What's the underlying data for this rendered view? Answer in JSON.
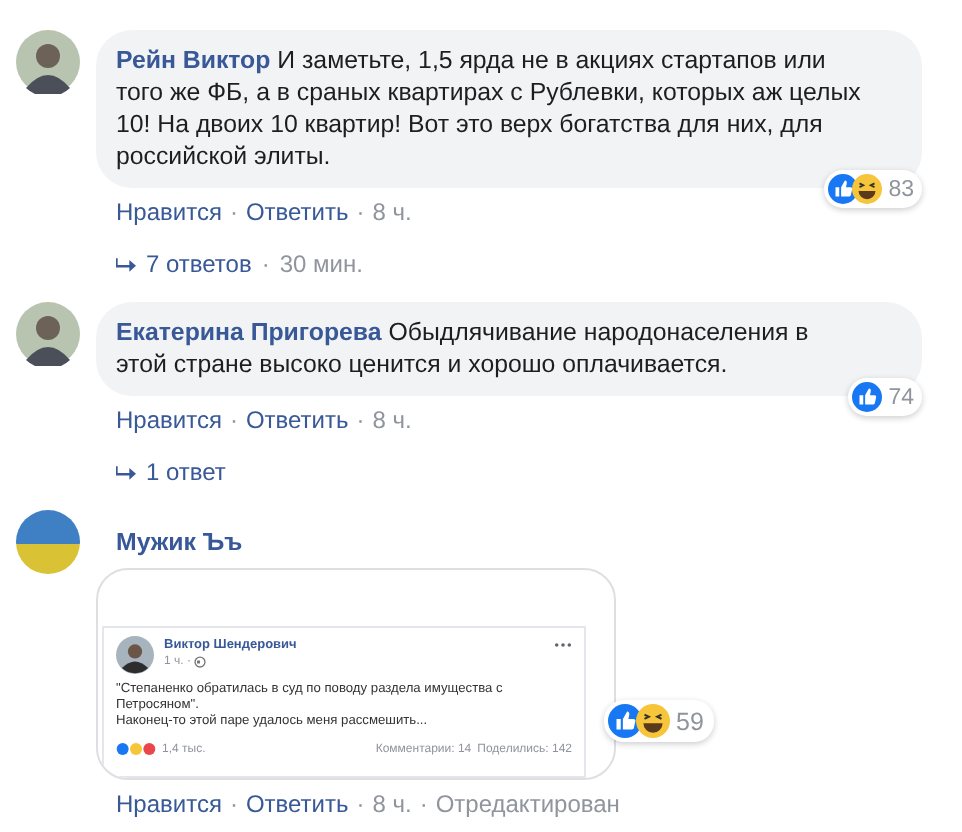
{
  "separator": "·",
  "comments": [
    {
      "kind": "text",
      "avatar": {
        "kind": "photo"
      },
      "author": "Рейн Виктор",
      "text": "И заметьте, 1,5 ярда не в акциях стартапов или того же ФБ, а в сраных квартирах с Рублевки, которых аж целых 10! На двоих 10 квартир! Вот это верх богатства для них, для российской элиты.",
      "reactions": [
        {
          "kind": "like"
        },
        {
          "kind": "haha"
        }
      ],
      "reaction_count": "83",
      "actions": [
        "Нравится",
        "Ответить"
      ],
      "time": "8 ч.",
      "replies": {
        "label": "7 ответов",
        "time": "30 мин."
      }
    },
    {
      "kind": "text",
      "avatar": {
        "kind": "photo"
      },
      "author": "Екатерина Пригорева",
      "text": "Обыдлячивание народонаселения в этой стране высоко ценится и хорошо оплачивается.",
      "reactions": [
        {
          "kind": "like"
        }
      ],
      "reaction_count": "74",
      "actions": [
        "Нравится",
        "Ответить"
      ],
      "time": "8 ч.",
      "replies": {
        "label": "1 ответ"
      }
    },
    {
      "kind": "attachment",
      "avatar": {
        "kind": "flag"
      },
      "author": "Мужик Ъъ",
      "attachment": {
        "author": "Виктор Шендерович",
        "time": "1 ч.",
        "paragraphs": [
          "\"Степаненко обратилась в суд по поводу раздела имущества с Петросяном\".",
          "Наконец-то этой паре удалось меня рассмешить..."
        ],
        "reaction_count": "1,4 тыс.",
        "comments": "Комментарии: 14",
        "shares": "Поделились: 142"
      },
      "reactions": [
        {
          "kind": "like"
        },
        {
          "kind": "haha"
        }
      ],
      "reaction_count": "59",
      "actions": [
        "Нравится",
        "Ответить"
      ],
      "time": "8 ч.",
      "edited": "Отредактирован"
    }
  ]
}
